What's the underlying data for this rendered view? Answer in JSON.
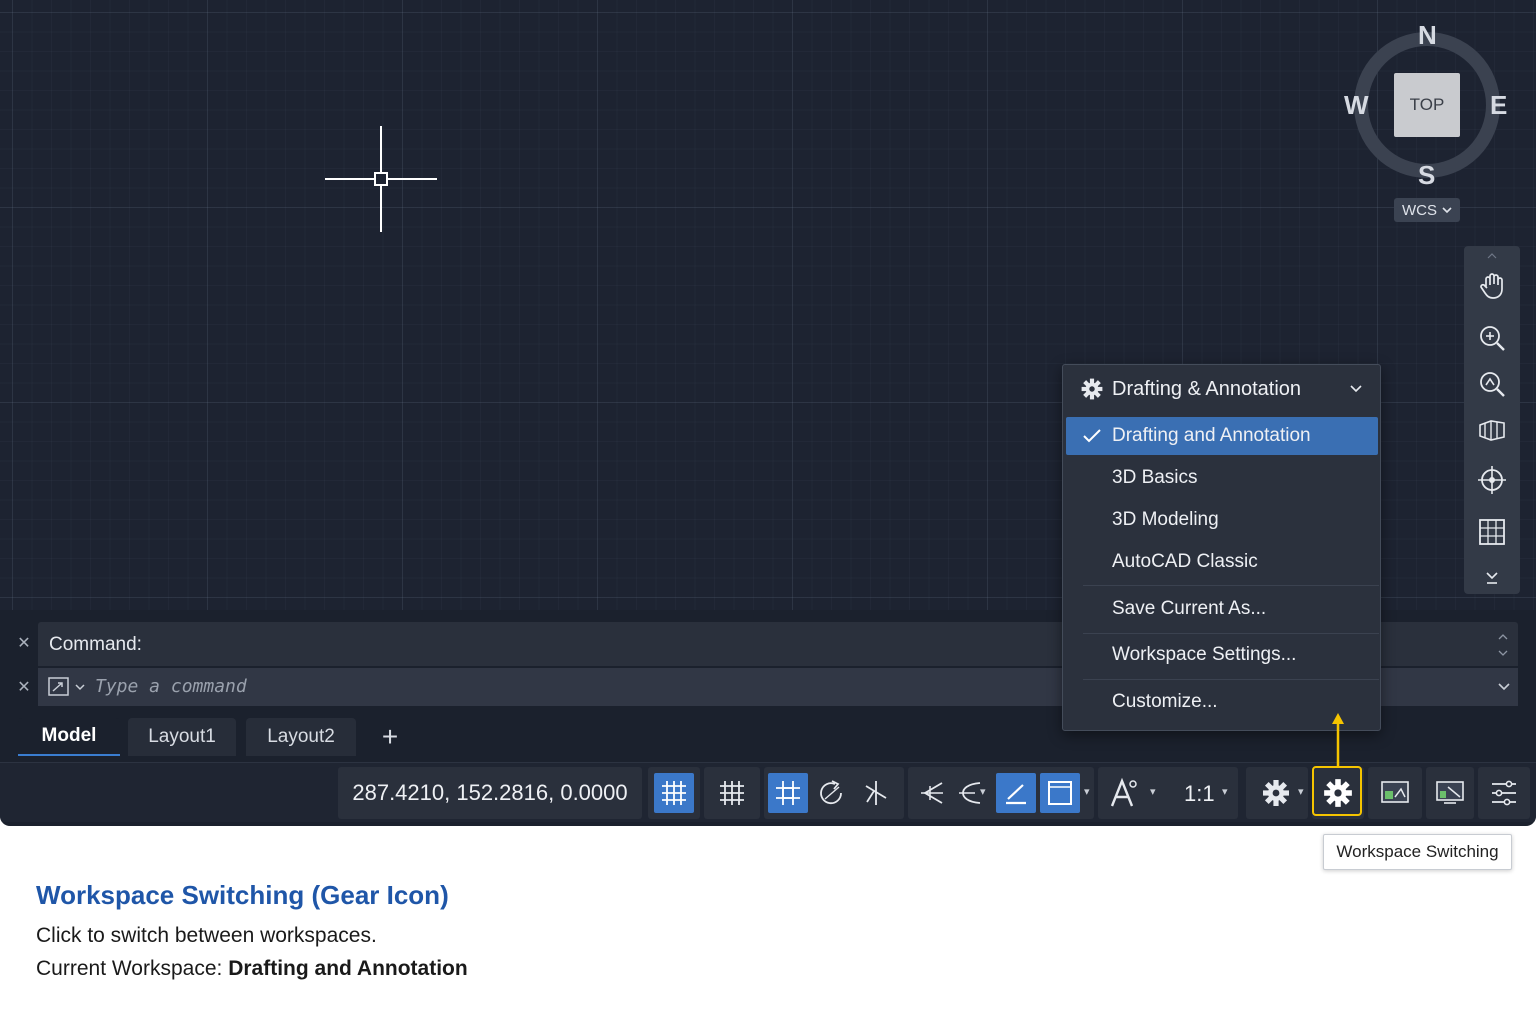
{
  "viewcube": {
    "north": "N",
    "south": "S",
    "east": "E",
    "west": "W",
    "face": "TOP",
    "coord_system": "WCS"
  },
  "navbar": {
    "tools": [
      "pan-icon",
      "zoom-extents-icon",
      "zoom-window-icon",
      "orbit-icon",
      "steering-wheel-icon",
      "show-motion-icon"
    ]
  },
  "command": {
    "history_label": "Command:",
    "placeholder": "Type a command"
  },
  "tabs": {
    "items": [
      {
        "label": "Model",
        "active": true
      },
      {
        "label": "Layout1",
        "active": false
      },
      {
        "label": "Layout2",
        "active": false
      }
    ],
    "add_label": "+"
  },
  "statusbar": {
    "coordinates": "287.4210, 152.2816, 0.0000",
    "annotation_scale": "1:1",
    "toggles": {
      "grid_display": true,
      "snap_mode": false,
      "ortho": true,
      "polar": false,
      "osnap": false,
      "lineweight": true,
      "transparency": true
    }
  },
  "workspace_menu": {
    "current": "Drafting & Annotation",
    "items": [
      {
        "label": "Drafting and Annotation",
        "selected": true
      },
      {
        "label": "3D Basics",
        "selected": false
      },
      {
        "label": "3D Modeling",
        "selected": false
      },
      {
        "label": "AutoCAD Classic",
        "selected": false
      }
    ],
    "actions": [
      "Save Current As...",
      "Workspace Settings...",
      "Customize..."
    ]
  },
  "tooltip": "Workspace Switching",
  "caption": {
    "title": "Workspace Switching (Gear Icon)",
    "description": "Click to switch between workspaces.",
    "current_label": "Current Workspace: ",
    "current_value": "Drafting and Annotation"
  },
  "colors": {
    "viewport_bg": "#1d2331",
    "accent_blue": "#3b78c9",
    "highlight_yellow": "#f5c400",
    "caption_blue": "#1f56a8"
  }
}
